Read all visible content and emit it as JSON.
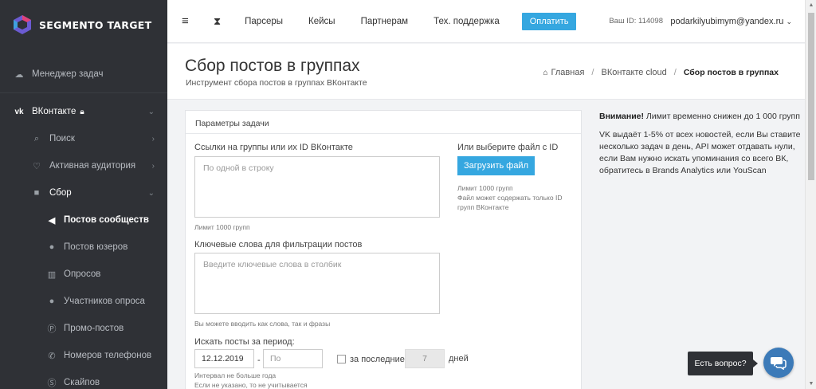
{
  "brand": {
    "name": "SEGMENTO TARGET",
    "accent": "#35a7e0",
    "sidebar_bg": "#2f3136"
  },
  "sidebar": {
    "items": [
      {
        "label": "Менеджер задач",
        "icon": "cloud-icon"
      },
      {
        "label": "ВКонтакте",
        "icon": "vk-icon"
      },
      {
        "label": "Поиск",
        "icon": "search-icon"
      },
      {
        "label": "Активная аудитория",
        "icon": "heart-icon"
      },
      {
        "label": "Сбор",
        "icon": "truck-icon"
      },
      {
        "label": "Постов сообществ",
        "icon": "megaphone-icon"
      },
      {
        "label": "Постов юзеров",
        "icon": "user-icon"
      },
      {
        "label": "Опросов",
        "icon": "bar-chart-icon"
      },
      {
        "label": "Участников опроса",
        "icon": "users-icon"
      },
      {
        "label": "Промо-постов",
        "icon": "promo-icon"
      },
      {
        "label": "Номеров телефонов",
        "icon": "phone-icon"
      },
      {
        "label": "Скайпов",
        "icon": "skype-icon"
      }
    ]
  },
  "topbar": {
    "links": [
      "Парсеры",
      "Кейсы",
      "Партнерам",
      "Тех. поддержка"
    ],
    "pay_label": "Оплатить",
    "user_id": "Ваш ID: 114098",
    "user_email": "podarkilyubimym@yandex.ru"
  },
  "header": {
    "title": "Сбор постов в группах",
    "subtitle": "Инструмент сбора постов в группах ВКонтакте",
    "breadcrumb": [
      "Главная",
      "ВКонтакте cloud",
      "Сбор постов в группах"
    ]
  },
  "form": {
    "card_title": "Параметры задачи",
    "groups_label": "Ссылки на группы или их ID ВКонтакте",
    "groups_placeholder": "По одной в строку",
    "groups_hint": "Лимит 1000 групп",
    "file_label": "Или выберите файл с ID",
    "upload_label": "Загрузить файл",
    "file_hint_1": "Лимит 1000 групп",
    "file_hint_2": "Файл может содержать только ID",
    "file_hint_3": "групп ВКонтакте",
    "keywords_label": "Ключевые слова для фильтрации постов",
    "keywords_placeholder": "Введите ключевые слова в столбик",
    "keywords_hint": "Вы можете вводить как слова, так и фразы",
    "period_label": "Искать посты за период:",
    "date_from": "12.12.2019",
    "date_to_placeholder": "По",
    "dash": "-",
    "last_label": "за последние",
    "last_days": "7",
    "days_label": "дней",
    "period_hint_1": "Интервал не больше года",
    "period_hint_2": "Если не указано, то не учитывается"
  },
  "notice": {
    "title": "Внимание!",
    "text1": "Лимит временно снижен до 1 000 групп",
    "text2": "VK выдаёт 1-5% от всех новостей, если Вы ставите несколько задач в день, API может отдавать нули, если Вам нужно искать упоминания со всего ВК, обратитесь в Brands Analytics или YouScan"
  },
  "chat": {
    "label": "Есть вопрос?"
  }
}
